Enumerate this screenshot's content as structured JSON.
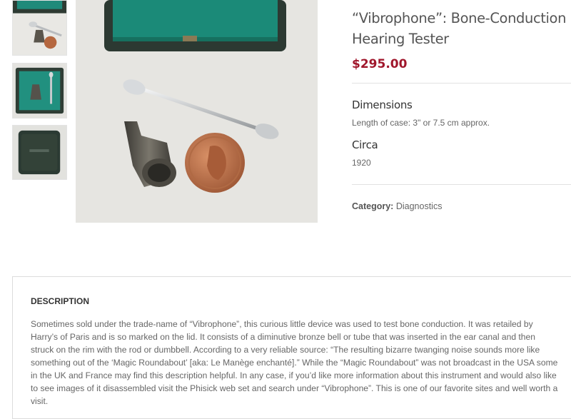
{
  "gallery": {
    "thumbnails": [
      {
        "icon": "thumbnail-rod-and-coin"
      },
      {
        "icon": "thumbnail-open-case"
      },
      {
        "icon": "thumbnail-closed-case"
      }
    ],
    "main_image": {
      "icon": "product-photo-rod-bell-coin"
    }
  },
  "product": {
    "title": "“Vibrophone”: Bone-Conduction Hearing Tester",
    "price": "$295.00",
    "attributes": [
      {
        "label": "Dimensions",
        "value": "Length of case: 3\" or 7.5 cm approx."
      },
      {
        "label": "Circa",
        "value": "1920"
      }
    ],
    "category_label": "Category:",
    "category_value": "Diagnostics"
  },
  "description": {
    "heading": "DESCRIPTION",
    "text": "Sometimes sold under the trade-name of “Vibrophone”, this curious little device was used to test bone conduction. It was retailed by Harry’s of Paris and is so marked on the lid. It consists of a diminutive bronze bell or tube that was inserted in the ear canal and then struck on the rim with the rod or dumbbell. According to a very reliable source: “The resulting bizarre twanging noise sounds more like something out of the ‘Magic Roundabout’ [aka: Le Manège enchanté].” While the “Magic Roundabout” was not broadcast in the USA some in the UK and France may find this description helpful. In any case, if you’d like more information about this instrument and would also like to see images of it disassembled visit the Phisick web set and search under “Vibrophone”. This is one of our favorite sites and well worth a visit."
  },
  "colors": {
    "price": "#a0172c",
    "case_lining": "#1f8a7a"
  }
}
